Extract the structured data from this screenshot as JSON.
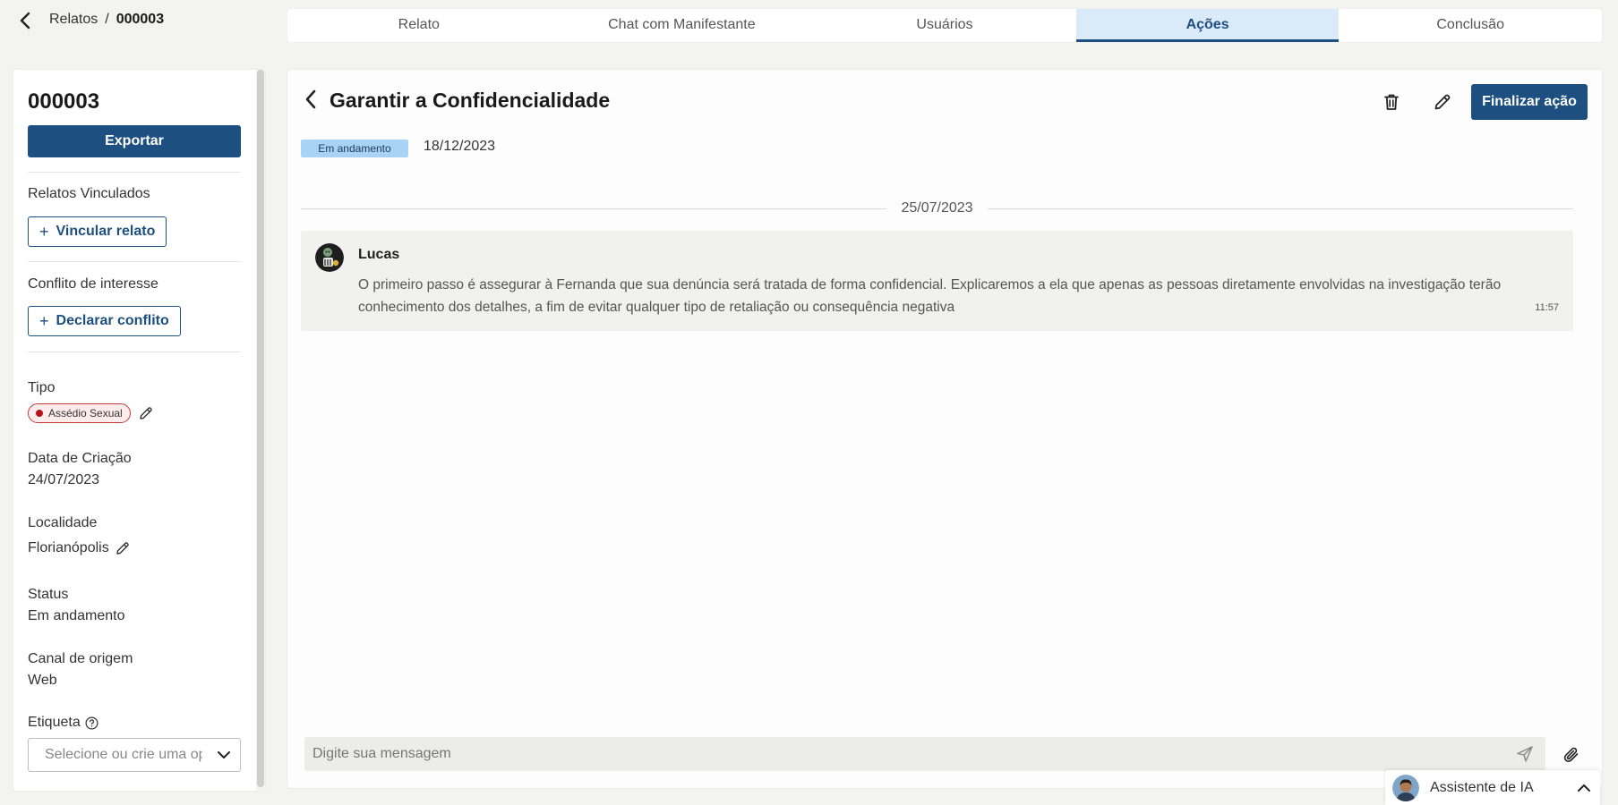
{
  "breadcrumb": {
    "parent": "Relatos",
    "separator": "/",
    "current": "000003"
  },
  "tabs": [
    {
      "label": "Relato",
      "active": false
    },
    {
      "label": "Chat com Manifestante",
      "active": false
    },
    {
      "label": "Usuários",
      "active": false
    },
    {
      "label": "Ações",
      "active": true
    },
    {
      "label": "Conclusão",
      "active": false
    }
  ],
  "sidebar": {
    "report_id": "000003",
    "export_label": "Exportar",
    "linked_reports_label": "Relatos Vinculados",
    "link_report_button": "Vincular relato",
    "conflict_label": "Conflito de interesse",
    "declare_conflict_button": "Declarar conflito",
    "type_label": "Tipo",
    "type_value": "Assédio Sexual",
    "created_label": "Data de Criação",
    "created_value": "24/07/2023",
    "location_label": "Localidade",
    "location_value": "Florianópolis",
    "status_label": "Status",
    "status_value": "Em andamento",
    "channel_label": "Canal de origem",
    "channel_value": "Web",
    "tag_label": "Etiqueta",
    "tag_placeholder": "Selecione ou crie uma opção"
  },
  "action": {
    "title": "Garantir a Confidencialidade",
    "finish_button": "Finalizar ação",
    "status_badge": "Em andamento",
    "due_date": "18/12/2023"
  },
  "thread": {
    "date_separator": "25/07/2023",
    "messages": [
      {
        "author": "Lucas",
        "text": "O primeiro passo é assegurar à Fernanda que sua denúncia será tratada de forma confidencial. Explicaremos a ela que apenas as pessoas diretamente envolvidas na investigação terão conhecimento dos detalhes, a fim de evitar qualquer tipo de retaliação ou consequência negativa",
        "time": "11:57"
      }
    ]
  },
  "composer": {
    "placeholder": "Digite sua mensagem"
  },
  "assistant": {
    "label": "Assistente de IA"
  },
  "colors": {
    "primary": "#1d4f80",
    "active_tab_bg": "#dbeaf8",
    "status_badge_bg": "#a8d3f7",
    "type_badge_border": "#c63a3a",
    "type_badge_dot": "#b3141b",
    "page_bg": "#f3f3f2"
  },
  "icons": {
    "back": "chevron-left-icon",
    "delete": "trash-icon",
    "edit": "pencil-icon",
    "add": "plus-icon",
    "help": "question-circle-icon",
    "dropdown": "chevron-down-icon",
    "send": "send-icon",
    "attach": "paperclip-icon",
    "collapse": "chevron-up-icon"
  }
}
